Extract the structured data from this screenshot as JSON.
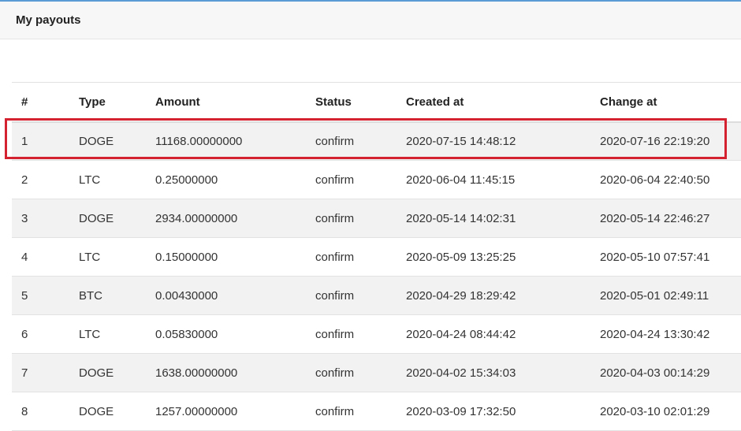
{
  "panel": {
    "title": "My payouts"
  },
  "table": {
    "columns": [
      "#",
      "Type",
      "Amount",
      "Status",
      "Created at",
      "Change at"
    ],
    "rows": [
      {
        "num": "1",
        "type": "DOGE",
        "amount": "11168.00000000",
        "status": "confirm",
        "created": "2020-07-15 14:48:12",
        "changed": "2020-07-16 22:19:20"
      },
      {
        "num": "2",
        "type": "LTC",
        "amount": "0.25000000",
        "status": "confirm",
        "created": "2020-06-04 11:45:15",
        "changed": "2020-06-04 22:40:50"
      },
      {
        "num": "3",
        "type": "DOGE",
        "amount": "2934.00000000",
        "status": "confirm",
        "created": "2020-05-14 14:02:31",
        "changed": "2020-05-14 22:46:27"
      },
      {
        "num": "4",
        "type": "LTC",
        "amount": "0.15000000",
        "status": "confirm",
        "created": "2020-05-09 13:25:25",
        "changed": "2020-05-10 07:57:41"
      },
      {
        "num": "5",
        "type": "BTC",
        "amount": "0.00430000",
        "status": "confirm",
        "created": "2020-04-29 18:29:42",
        "changed": "2020-05-01 02:49:11"
      },
      {
        "num": "6",
        "type": "LTC",
        "amount": "0.05830000",
        "status": "confirm",
        "created": "2020-04-24 08:44:42",
        "changed": "2020-04-24 13:30:42"
      },
      {
        "num": "7",
        "type": "DOGE",
        "amount": "1638.00000000",
        "status": "confirm",
        "created": "2020-04-02 15:34:03",
        "changed": "2020-04-03 00:14:29"
      },
      {
        "num": "8",
        "type": "DOGE",
        "amount": "1257.00000000",
        "status": "confirm",
        "created": "2020-03-09 17:32:50",
        "changed": "2020-03-10 02:01:29"
      }
    ]
  },
  "colors": {
    "accent_top": "#5b9bd5",
    "highlight_border": "#d42230",
    "stripe": "#f2f2f2"
  }
}
